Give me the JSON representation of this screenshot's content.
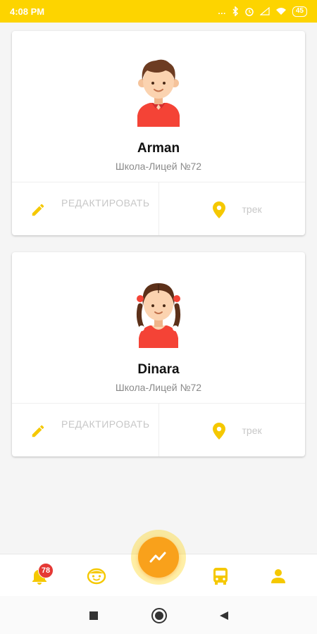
{
  "status_bar": {
    "time": "4:08 PM",
    "battery": "45",
    "icons": [
      "bluetooth-icon",
      "alarm-icon",
      "signal-icon",
      "wifi-icon",
      "battery-icon"
    ]
  },
  "children": [
    {
      "name": "Arman",
      "school": "Школа-Лицей №72",
      "avatar": "boy-avatar",
      "edit_label": "РЕДАКТИРОВАТЬ",
      "track_label": "трек"
    },
    {
      "name": "Dinara",
      "school": "Школа-Лицей №72",
      "avatar": "girl-avatar",
      "edit_label": "РЕДАКТИРОВАТЬ",
      "track_label": "трек"
    }
  ],
  "bottom_nav": {
    "notifications_badge": "78",
    "items": [
      "bell-icon",
      "face-icon",
      "activity-fab",
      "bus-icon",
      "user-icon"
    ]
  },
  "colors": {
    "accent": "#fdd400",
    "icon_yellow": "#f5c800",
    "fab": "#f9a11b",
    "badge": "#e53935",
    "muted_text": "#c7c7c7"
  }
}
